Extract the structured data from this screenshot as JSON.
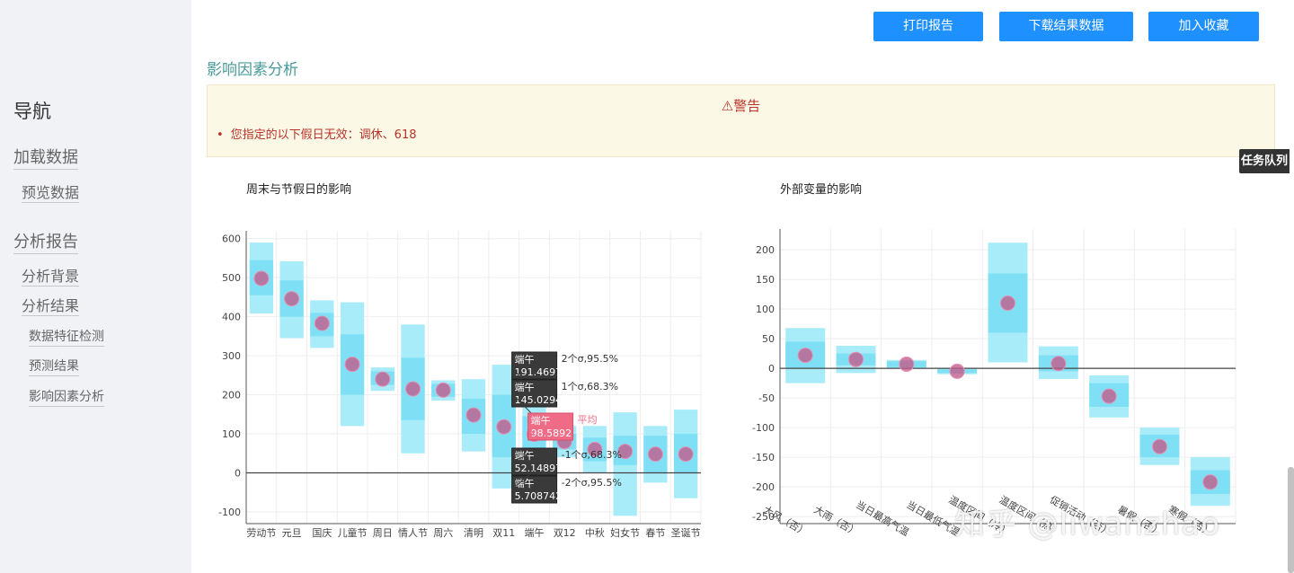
{
  "nav": {
    "title": "导航",
    "load_data": "加载数据",
    "preview_data": "预览数据",
    "report": "分析报告",
    "background": "分析背景",
    "results": "分析结果",
    "feature_check": "数据特征检测",
    "forecast": "预测结果",
    "factor_analysis": "影响因素分析"
  },
  "buttons": {
    "print": "打印报告",
    "download": "下载结果数据",
    "favorite": "加入收藏"
  },
  "section_title": "影响因素分析",
  "warning": {
    "title": "⚠警告",
    "message": "您指定的以下假日无效：调休、618"
  },
  "task_queue": "任务队列",
  "watermark": "知乎 @liwanzhao",
  "colors": {
    "band_outer": "#a8ecfa",
    "band_inner": "#7fe0f5",
    "dot": "#c25a8a",
    "zero_line": "#444444",
    "tooltip_dark": "#3a3a3a",
    "tooltip_mean": "#ef6b86",
    "button": "#1e90ff"
  },
  "chart_data": [
    {
      "type": "error_band",
      "title": "周末与节假日的影响",
      "ylim": [
        -130,
        620
      ],
      "yticks": [
        600,
        500,
        400,
        300,
        200,
        100,
        0,
        -100
      ],
      "categories": [
        "劳动节",
        "元旦",
        "国庆",
        "儿童节",
        "周日",
        "情人节",
        "周六",
        "清明",
        "双11",
        "端午",
        "双12",
        "中秋",
        "妇女节",
        "春节",
        "圣诞节"
      ],
      "mean": [
        498,
        446,
        383,
        278,
        240,
        215,
        212,
        148,
        118,
        98.5892,
        80,
        60,
        55,
        48,
        48
      ],
      "s1_low": [
        455,
        400,
        350,
        200,
        225,
        135,
        195,
        100,
        40,
        52.14897,
        60,
        30,
        20,
        0,
        0
      ],
      "s1_high": [
        545,
        493,
        410,
        355,
        260,
        295,
        228,
        190,
        200,
        145.0294,
        100,
        90,
        95,
        95,
        100
      ],
      "s2_low": [
        408,
        345,
        320,
        120,
        210,
        50,
        185,
        55,
        -40,
        5.708742,
        40,
        0,
        -110,
        -25,
        -65
      ],
      "s2_high": [
        590,
        542,
        442,
        437,
        270,
        380,
        237,
        240,
        277,
        191.4697,
        120,
        120,
        155,
        120,
        162
      ],
      "tooltips": {
        "category": "端午",
        "items": [
          {
            "label": "端午",
            "value": "191.4697",
            "desc": "2个σ,95.5%",
            "y": 191.4697
          },
          {
            "label": "端午",
            "value": "145.0294",
            "desc": "1个σ,68.3%",
            "y": 145.0294
          },
          {
            "label": "端午",
            "value": "98.5892",
            "desc": "平均",
            "y": 98.5892,
            "highlight": true
          },
          {
            "label": "端午",
            "value": "52.14897",
            "desc": "-1个σ,68.3%",
            "y": 52.14897
          },
          {
            "label": "端午",
            "value": "5.708742",
            "desc": "-2个σ,95.5%",
            "y": 5.708742
          }
        ]
      }
    },
    {
      "type": "error_band",
      "title": "外部变量的影响",
      "ylim": [
        -262,
        235
      ],
      "yticks": [
        200,
        150,
        100,
        50,
        0,
        -50,
        -100,
        -150,
        -200,
        -250
      ],
      "categories": [
        "大风（否）",
        "大雨（否）",
        "当日最高气温",
        "当日最低气温",
        "温度区间（冷）",
        "温度区间（热）",
        "促销活动（否）",
        "暑假（否）",
        "寒假（否）"
      ],
      "mean": [
        22,
        15,
        7,
        -5,
        110,
        8,
        -47,
        -132,
        -192
      ],
      "s1_low": [
        0,
        5,
        2,
        -8,
        60,
        -5,
        -65,
        -150,
        -212
      ],
      "s1_high": [
        45,
        25,
        12,
        -2,
        160,
        22,
        -25,
        -112,
        -172
      ],
      "s2_low": [
        -25,
        -8,
        0,
        -10,
        10,
        -18,
        -83,
        -163,
        -232
      ],
      "s2_high": [
        68,
        38,
        14,
        0,
        212,
        37,
        -12,
        -100,
        -150
      ]
    }
  ]
}
